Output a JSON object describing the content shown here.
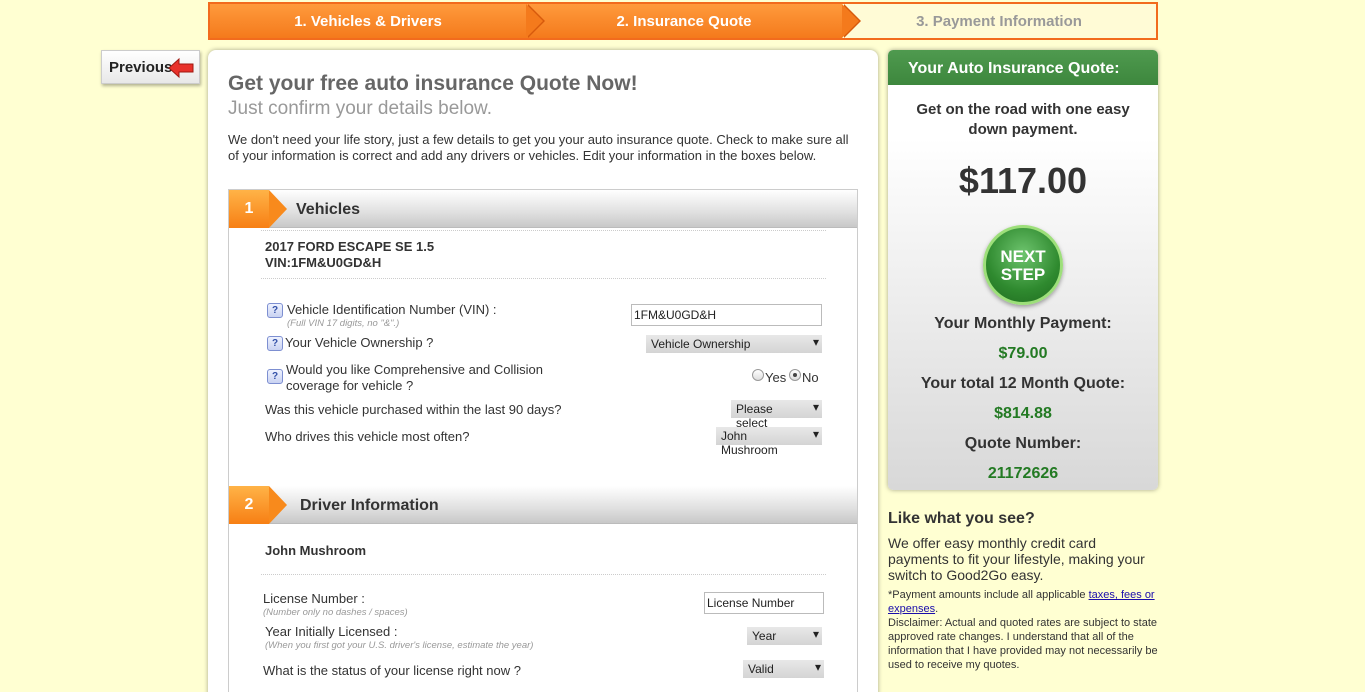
{
  "steps": [
    {
      "label": "1. Vehicles & Drivers"
    },
    {
      "label": "2. Insurance Quote"
    },
    {
      "label": "3. Payment Information"
    }
  ],
  "previous_label": "Previous",
  "main": {
    "title": "Get your free auto insurance Quote Now!",
    "subtitle": "Just confirm your details below.",
    "intro": "We don't need your life story, just a few details to get you your auto insurance quote. Check to make sure all of your information is correct and add any drivers or vehicles. Edit your information in the boxes below."
  },
  "vehicles": {
    "number": "1",
    "title": "Vehicles",
    "vehicle_name": "2017 FORD ESCAPE SE 1.5",
    "vehicle_vin": "VIN:1FM&U0GD&H",
    "vin_label": "Vehicle Identification Number (VIN) :",
    "vin_hint": "(Full VIN 17 digits, no \"&\".)",
    "vin_value": "1FM&U0GD&H",
    "ownership_label": "Your Vehicle Ownership ?",
    "ownership_value": "Vehicle Ownership",
    "coverage_label_1": "Would you like Comprehensive and Collision",
    "coverage_label_2": "coverage for vehicle ?",
    "yes_label": "Yes",
    "no_label": "No",
    "purchased_label": "Was this vehicle purchased within the last 90 days?",
    "purchased_value": "Please select",
    "driver_label": "Who drives this vehicle most often?",
    "driver_value": "John Mushroom"
  },
  "drivers": {
    "number": "2",
    "title": "Driver Information",
    "driver_name": "John Mushroom",
    "license_label": "License Number :",
    "license_hint": "(Number only no dashes / spaces)",
    "license_placeholder": "License Number",
    "year_label": "Year Initially Licensed :",
    "year_hint": "(When you first got your U.S. driver's license, estimate the year)",
    "year_value": "Year",
    "status_label": "What is the status of your license right now ?",
    "status_value": "Valid"
  },
  "quote": {
    "header": "Your Auto Insurance Quote:",
    "tagline": "Get on the road with one easy down payment.",
    "price": "$117.00",
    "next_line1": "NEXT",
    "next_line2": "STEP",
    "monthly_label": "Your Monthly Payment:",
    "monthly_value": "$79.00",
    "total_label": "Your total 12 Month Quote:",
    "total_value": "$814.88",
    "number_label": "Quote Number:",
    "number_value": "21172626"
  },
  "like": {
    "title": "Like what you see?",
    "text": "We offer easy monthly credit card payments to fit your lifestyle, making your switch to Good2Go easy.",
    "fine_prefix": "*Payment amounts include all applicable ",
    "fine_link": "taxes, fees or expenses",
    "fine_suffix": ".",
    "disclaimer": "Disclaimer: Actual and quoted rates are subject to state approved rate changes. I understand that all of the information that I have provided may not necessarily be used to receive my quotes."
  },
  "colors": {
    "accent_orange": "#f47a1c",
    "quote_green": "#3d873d",
    "value_green": "#237a23",
    "background": "#ffffd2"
  }
}
